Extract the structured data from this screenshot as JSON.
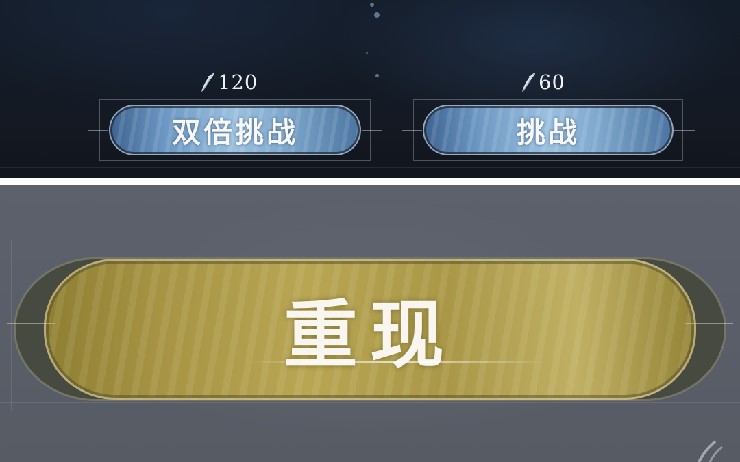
{
  "top_panel": {
    "double_challenge": {
      "cost_value": "120",
      "label": "双倍挑战",
      "cost_icon": "quill-icon"
    },
    "challenge": {
      "cost_value": "60",
      "label": "挑战",
      "cost_icon": "quill-icon"
    },
    "button_color": "#7fa8cd",
    "background_color": "#141a24"
  },
  "bottom_panel": {
    "replay": {
      "label": "重现"
    },
    "button_color": "#b8a653",
    "background_color": "#5a5e68"
  }
}
